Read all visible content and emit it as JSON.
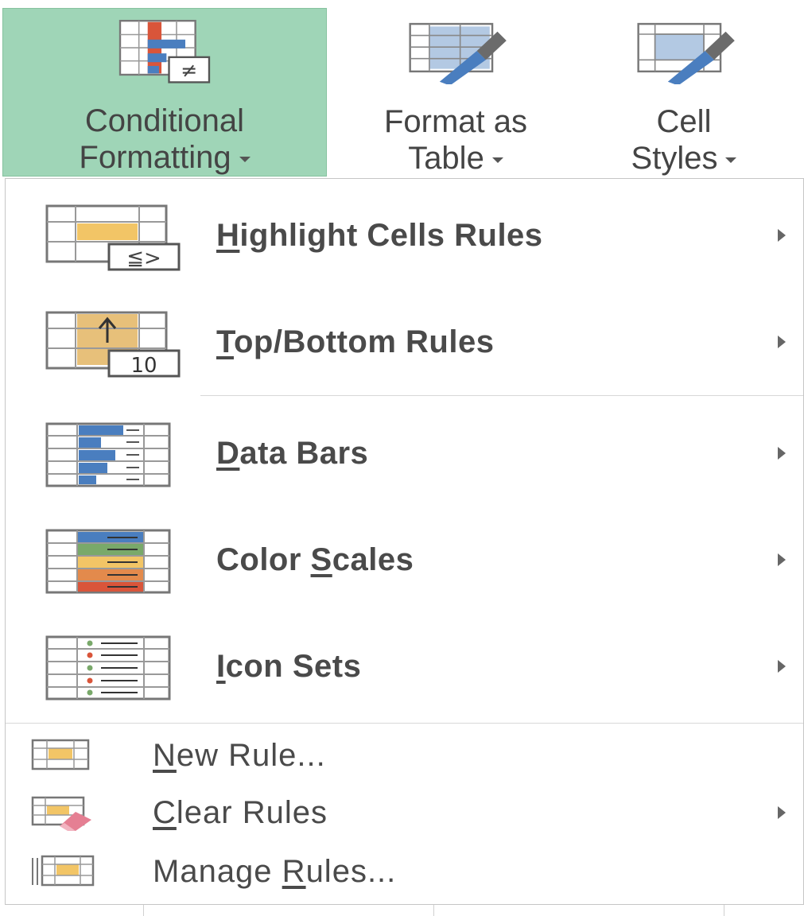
{
  "ribbon": {
    "conditional_formatting": {
      "line1": "Conditional",
      "line2": "Formatting",
      "active": true
    },
    "format_as_table": {
      "line1": "Format as",
      "line2": "Table"
    },
    "cell_styles": {
      "line1": "Cell",
      "line2": "Styles"
    }
  },
  "menu": {
    "items": [
      {
        "pre": "",
        "u": "H",
        "post": "ighlight Cells Rules",
        "icon": "highlight-cells-rules-icon",
        "submenu": true
      },
      {
        "pre": "",
        "u": "T",
        "post": "op/Bottom Rules",
        "icon": "top-bottom-rules-icon",
        "icon_text": "10",
        "submenu": true
      },
      {
        "pre": "",
        "u": "D",
        "post": "ata Bars",
        "icon": "data-bars-icon",
        "submenu": true
      },
      {
        "pre": "Color ",
        "u": "S",
        "post": "cales",
        "icon": "color-scales-icon",
        "submenu": true
      },
      {
        "pre": "",
        "u": "I",
        "post": "con Sets",
        "icon": "icon-sets-icon",
        "submenu": true
      }
    ],
    "small_items": [
      {
        "pre": "",
        "u": "N",
        "post": "ew Rule...",
        "icon": "new-rule-icon",
        "submenu": false
      },
      {
        "pre": "",
        "u": "C",
        "post": "lear Rules",
        "icon": "clear-rules-icon",
        "submenu": true
      },
      {
        "pre": "Manage ",
        "u": "R",
        "post": "ules...",
        "icon": "manage-rules-icon",
        "submenu": false
      }
    ]
  },
  "colors": {
    "active_button": "#9fd5b7",
    "blue": "#4a7ebf",
    "red": "#d9553a",
    "yellow": "#f2c566",
    "green": "#79a96a",
    "orange": "#e38a4c"
  }
}
